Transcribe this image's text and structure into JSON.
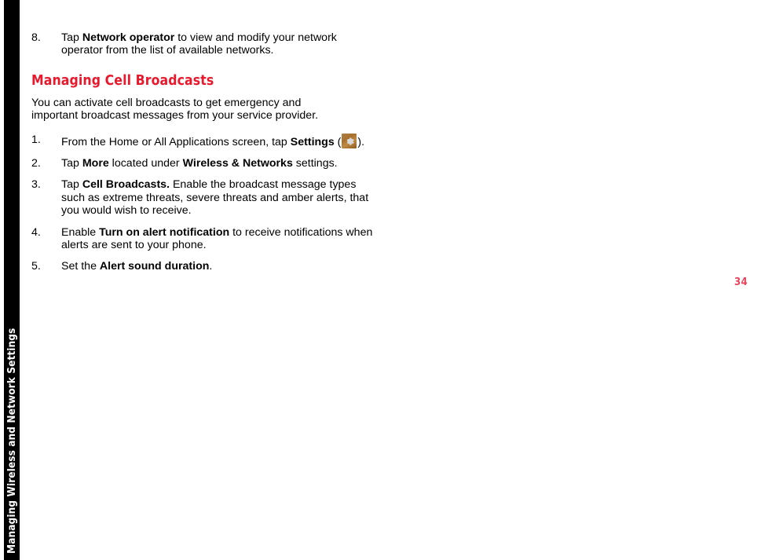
{
  "page": {
    "number": "34",
    "number_color": "#e8445c",
    "background_color": "#ffffff"
  },
  "chapter_tab": {
    "label": "Managing Wireless and Network Settings",
    "background_color": "#000000",
    "text_color": "#ffffff"
  },
  "content": {
    "top_step": {
      "number": "8.",
      "text_parts": [
        {
          "text": "Tap ",
          "bold": false
        },
        {
          "text": "Network operator",
          "bold": true
        },
        {
          "text": " to view and modify your network operator from the list of available networks.",
          "bold": false
        }
      ],
      "plain": "Tap Network operator to view and modify your network operator from the list of available networks."
    },
    "heading": {
      "text": "Managing Cell Broadcasts",
      "color": "#e8192c"
    },
    "paragraph": "You can activate cell broadcasts to get emergency and important broadcast messages from your service provider.",
    "steps": [
      {
        "number": "1.",
        "plain": "From the Home or All Applications screen, tap Settings ( ).",
        "parts": [
          {
            "text": "From the Home or All Applications screen, tap ",
            "bold": false
          },
          {
            "text": "Settings",
            "bold": true
          },
          {
            "text": " (",
            "bold": false
          },
          {
            "text": "settings-gear-icon",
            "icon": true
          },
          {
            "text": ").",
            "bold": false
          }
        ]
      },
      {
        "number": "2.",
        "plain": "Tap More located under Wireless & Networks settings.",
        "parts": [
          {
            "text": "Tap ",
            "bold": false
          },
          {
            "text": "More",
            "bold": true
          },
          {
            "text": " located under ",
            "bold": false
          },
          {
            "text": "Wireless & Networks",
            "bold": true
          },
          {
            "text": " settings.",
            "bold": false
          }
        ]
      },
      {
        "number": "3.",
        "plain": "Tap Cell Broadcasts. Enable the broadcast message types such as extreme threats, severe threats and amber alerts, that you would wish to receive.",
        "parts": [
          {
            "text": "Tap ",
            "bold": false
          },
          {
            "text": "Cell Broadcasts.",
            "bold": true
          },
          {
            "text": " Enable the broadcast message types such as extreme threats, severe threats and amber alerts, that you would wish to receive.",
            "bold": false
          }
        ]
      },
      {
        "number": "4.",
        "plain": "Enable Turn on alert notification to receive notifications when alerts are sent to your phone.",
        "parts": [
          {
            "text": "Enable ",
            "bold": false
          },
          {
            "text": "Turn on alert notification",
            "bold": true
          },
          {
            "text": " to receive notifications when alerts are sent to your phone.",
            "bold": false
          }
        ]
      },
      {
        "number": "5.",
        "plain": "Set the Alert sound duration.",
        "parts": [
          {
            "text": "Set the ",
            "bold": false
          },
          {
            "text": "Alert sound duration",
            "bold": true
          },
          {
            "text": ".",
            "bold": false
          }
        ]
      }
    ]
  },
  "icons": {
    "settings_gear": {
      "name": "settings-gear-icon",
      "background_color": "#a8702f",
      "glyph_color": "#d9d9d9"
    }
  }
}
